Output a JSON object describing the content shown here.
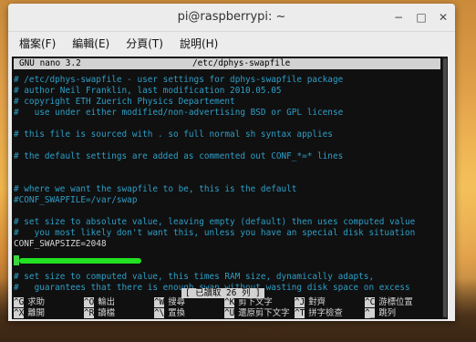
{
  "window": {
    "title": "pi@raspberrypi: ~",
    "min_glyph": "−",
    "max_glyph": "□",
    "close_glyph": "✕"
  },
  "menu": [
    {
      "label": "檔案(F)"
    },
    {
      "label": "編輯(E)"
    },
    {
      "label": "分頁(T)"
    },
    {
      "label": "說明(H)"
    }
  ],
  "nano": {
    "version": "GNU nano 3.2",
    "filename": "/etc/dphys-swapfile",
    "lines": [
      {
        "text": "# /etc/dphys-swapfile - user settings for dphys-swapfile package",
        "kind": "comment"
      },
      {
        "text": "# author Neil Franklin, last modification 2010.05.05",
        "kind": "comment"
      },
      {
        "text": "# copyright ETH Zuerich Physics Departement",
        "kind": "comment"
      },
      {
        "text": "#   use under either modified/non-advertising BSD or GPL license",
        "kind": "comment"
      },
      {
        "text": "",
        "kind": "plain"
      },
      {
        "text": "# this file is sourced with . so full normal sh syntax applies",
        "kind": "comment"
      },
      {
        "text": "",
        "kind": "plain"
      },
      {
        "text": "# the default settings are added as commented out CONF_*=* lines",
        "kind": "comment"
      },
      {
        "text": "",
        "kind": "plain"
      },
      {
        "text": "",
        "kind": "plain"
      },
      {
        "text": "# where we want the swapfile to be, this is the default",
        "kind": "comment"
      },
      {
        "text": "#CONF_SWAPFILE=/var/swap",
        "kind": "comment"
      },
      {
        "text": "",
        "kind": "plain"
      },
      {
        "text": "# set size to absolute value, leaving empty (default) then uses computed value",
        "kind": "comment"
      },
      {
        "text": "#   you most likely don't want this, unless you have an special disk situation",
        "kind": "comment"
      },
      {
        "text": "CONF_SWAPSIZE=2048",
        "kind": "plain"
      },
      {
        "text": "",
        "kind": "plain"
      },
      {
        "text": "",
        "kind": "plain"
      },
      {
        "text": "# set size to computed value, this times RAM size, dynamically adapts,",
        "kind": "comment"
      },
      {
        "text": "#   guarantees that there is enough swap without wasting disk space on excess",
        "kind": "comment"
      }
    ],
    "status": "[ 已讀取 26 列 ]",
    "shortcuts_row1": [
      {
        "key": "^G",
        "label": "求助"
      },
      {
        "key": "^O",
        "label": "輸出"
      },
      {
        "key": "^W",
        "label": "搜尋"
      },
      {
        "key": "^K",
        "label": "剪下文字"
      },
      {
        "key": "^J",
        "label": "對齊"
      },
      {
        "key": "^C",
        "label": "游標位置"
      }
    ],
    "shortcuts_row2": [
      {
        "key": "^X",
        "label": "離開"
      },
      {
        "key": "^R",
        "label": "讀檔"
      },
      {
        "key": "^\\",
        "label": "置換"
      },
      {
        "key": "^U",
        "label": "還原剪下文字"
      },
      {
        "key": "^T",
        "label": "拼字檢查"
      },
      {
        "key": "^_",
        "label": "跳列"
      }
    ]
  },
  "colors": {
    "terminal_bg": "#101010",
    "comment": "#2e9ec6",
    "highlight_mark": "#22e022"
  }
}
